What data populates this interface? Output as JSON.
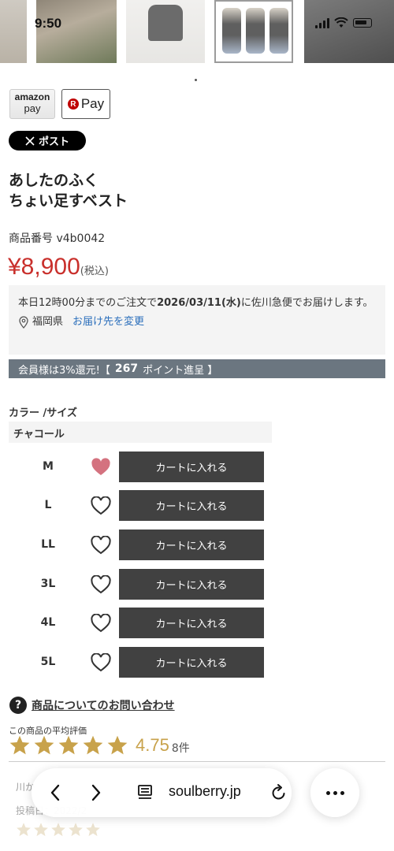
{
  "status": {
    "time": "9:50"
  },
  "pay": {
    "amazon_line1": "amazon",
    "amazon_line2": "pay",
    "rakuten_label": "Pay",
    "rakuten_mark": "R"
  },
  "share": {
    "x_post_label": "ポスト"
  },
  "product": {
    "title_line1": "あしたのふく",
    "title_line2": "ちょい足すベスト",
    "sku_label": "商品番号",
    "sku": "v4b0042",
    "price": "¥8,900",
    "tax_note": "(税込)"
  },
  "shipping": {
    "text_prefix": "本日12時00分までのご注文で",
    "date": "2026/03/11(水)",
    "text_suffix": "に佐川急便でお届けします。",
    "prefecture": "福岡県",
    "change_link": "お届け先を変更"
  },
  "points": {
    "prefix": "会員様は3%還元!【",
    "amount": "267",
    "suffix": "ポイント進呈 】"
  },
  "variants": {
    "label": "カラー /サイズ",
    "color": "チャコール",
    "cart_label": "カートに入れる",
    "sizes": [
      {
        "size": "M",
        "favorited": true
      },
      {
        "size": "L",
        "favorited": false
      },
      {
        "size": "LL",
        "favorited": false
      },
      {
        "size": "3L",
        "favorited": false
      },
      {
        "size": "4L",
        "favorited": false
      },
      {
        "size": "5L",
        "favorited": false
      }
    ]
  },
  "inquiry": {
    "label": "商品についてのお問い合わせ"
  },
  "rating": {
    "label": "この商品の平均評価",
    "score": "4.75",
    "count": "8件",
    "stars": 5,
    "color": "#c8a24b"
  },
  "review_preview": {
    "reviewer": "川か",
    "posted": "投稿日：2022/2"
  },
  "browser": {
    "url": "soulberry.jp"
  },
  "colors": {
    "price": "#c9302c",
    "cart_button": "#414141",
    "points_bar": "#6b7680",
    "heart_filled": "#d4727f",
    "link": "#2a6ebb"
  }
}
